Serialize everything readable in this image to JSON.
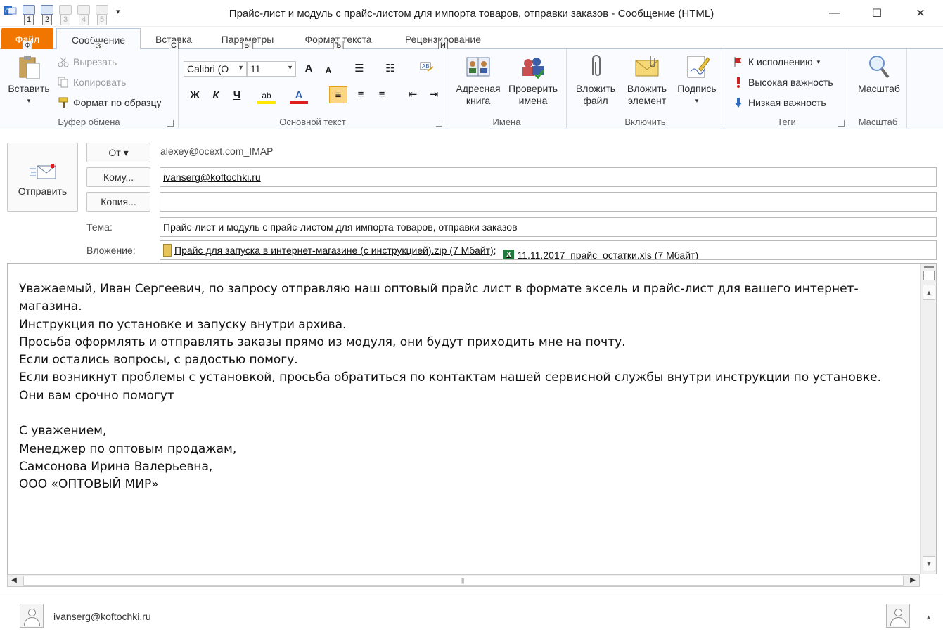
{
  "window": {
    "title": "Прайс-лист и модуль с прайс-листом для импорта товаров, отправки заказов  -  Сообщение (HTML)",
    "minimize": "—",
    "maximize": "☐",
    "close": "✕"
  },
  "qat": {
    "keytips": [
      "1",
      "2",
      "3",
      "4",
      "5"
    ],
    "more": "▾"
  },
  "tabs": [
    {
      "label": "Файл",
      "keytip": "Ф"
    },
    {
      "label": "Сообщение",
      "keytip": "З"
    },
    {
      "label": "Вставка",
      "keytip": "С"
    },
    {
      "label": "Параметры",
      "keytip": "Ы"
    },
    {
      "label": "Формат текста",
      "keytip": "Ъ"
    },
    {
      "label": "Рецензирование",
      "keytip": "И"
    }
  ],
  "ribbon_ctrls": {
    "collapse": "⌃",
    "help": "?"
  },
  "clipboard": {
    "paste": "Вставить",
    "paste_arrow": "▾",
    "cut": "Вырезать",
    "copy": "Копировать",
    "format_painter": "Формат по образцу",
    "label": "Буфер обмена"
  },
  "basic_text": {
    "font_name": "Calibri (О",
    "font_size": "11",
    "grow": "A",
    "shrink": "A",
    "bullets": "☰",
    "numbering": "☷",
    "bold": "Ж",
    "italic": "К",
    "underline": "Ч",
    "highlight": "ab",
    "font_color": "A",
    "align_left": "≡",
    "align_center": "≡",
    "align_right": "≡",
    "outdent": "⇤",
    "indent": "⇥",
    "label": "Основной текст"
  },
  "names": {
    "address_book": "Адресная книга",
    "check_names": "Проверить имена",
    "label": "Имена"
  },
  "include": {
    "attach_file": "Вложить файл",
    "attach_item": "Вложить элемент",
    "signature": "Подпись",
    "label": "Включить"
  },
  "tags": {
    "follow_up": "К исполнению",
    "high_importance": "Высокая важность",
    "low_importance": "Низкая важность",
    "label": "Теги"
  },
  "zoom": {
    "button": "Масштаб",
    "label": "Масштаб"
  },
  "header": {
    "send": "Отправить",
    "from_button": "От ▾",
    "from_value": "alexey@ocext.com_IMAP",
    "to_button": "Кому...",
    "to_value": "ivanserg@koftochki.ru",
    "cc_button": "Копия...",
    "cc_value": "",
    "subject_label": "Тема:",
    "subject_value": "Прайс-лист и модуль с прайс-листом для импорта товаров, отправки заказов",
    "attach_label": "Вложение:",
    "attachments": [
      "Прайс для запуска в интернет-магазине (с инструкцией).zip (7 Мбайт);",
      "11.11.2017_прайс_остатки.xls (7 Мбайт)"
    ]
  },
  "body": {
    "lines": [
      "Уважаемый, Иван Сергеевич, по запросу отправляю наш оптовый прайс лист в формате эксель и прайс-лист для вашего интернет-",
      "магазина.",
      "Инструкция по установке и запуску внутри архива.",
      "Просьба оформлять и отправлять заказы прямо из модуля, они будут приходить мне на почту.",
      "Если остались вопросы, с радостью помогу.",
      "Если возникнут проблемы с установкой, просьба обратиться по контактам нашей сервисной службы внутри инструкции по установке.",
      "Они вам срочно помогут",
      "",
      "С уважением,",
      "Менеджер по оптовым продажам,",
      "Самсонова Ирина Валерьевна,",
      "ООО «ОПТОВЫЙ МИР»"
    ]
  },
  "scroll": {
    "up": "▲",
    "down": "▼",
    "left": "◀",
    "right": "▶",
    "grip": "|||"
  },
  "people": {
    "name": "ivanserg@koftochki.ru",
    "toggle": "▲"
  },
  "colors": {
    "file_tab": "#f07600",
    "ribbon_bg": "#f9fbfe",
    "active_align": "#fcd582"
  }
}
